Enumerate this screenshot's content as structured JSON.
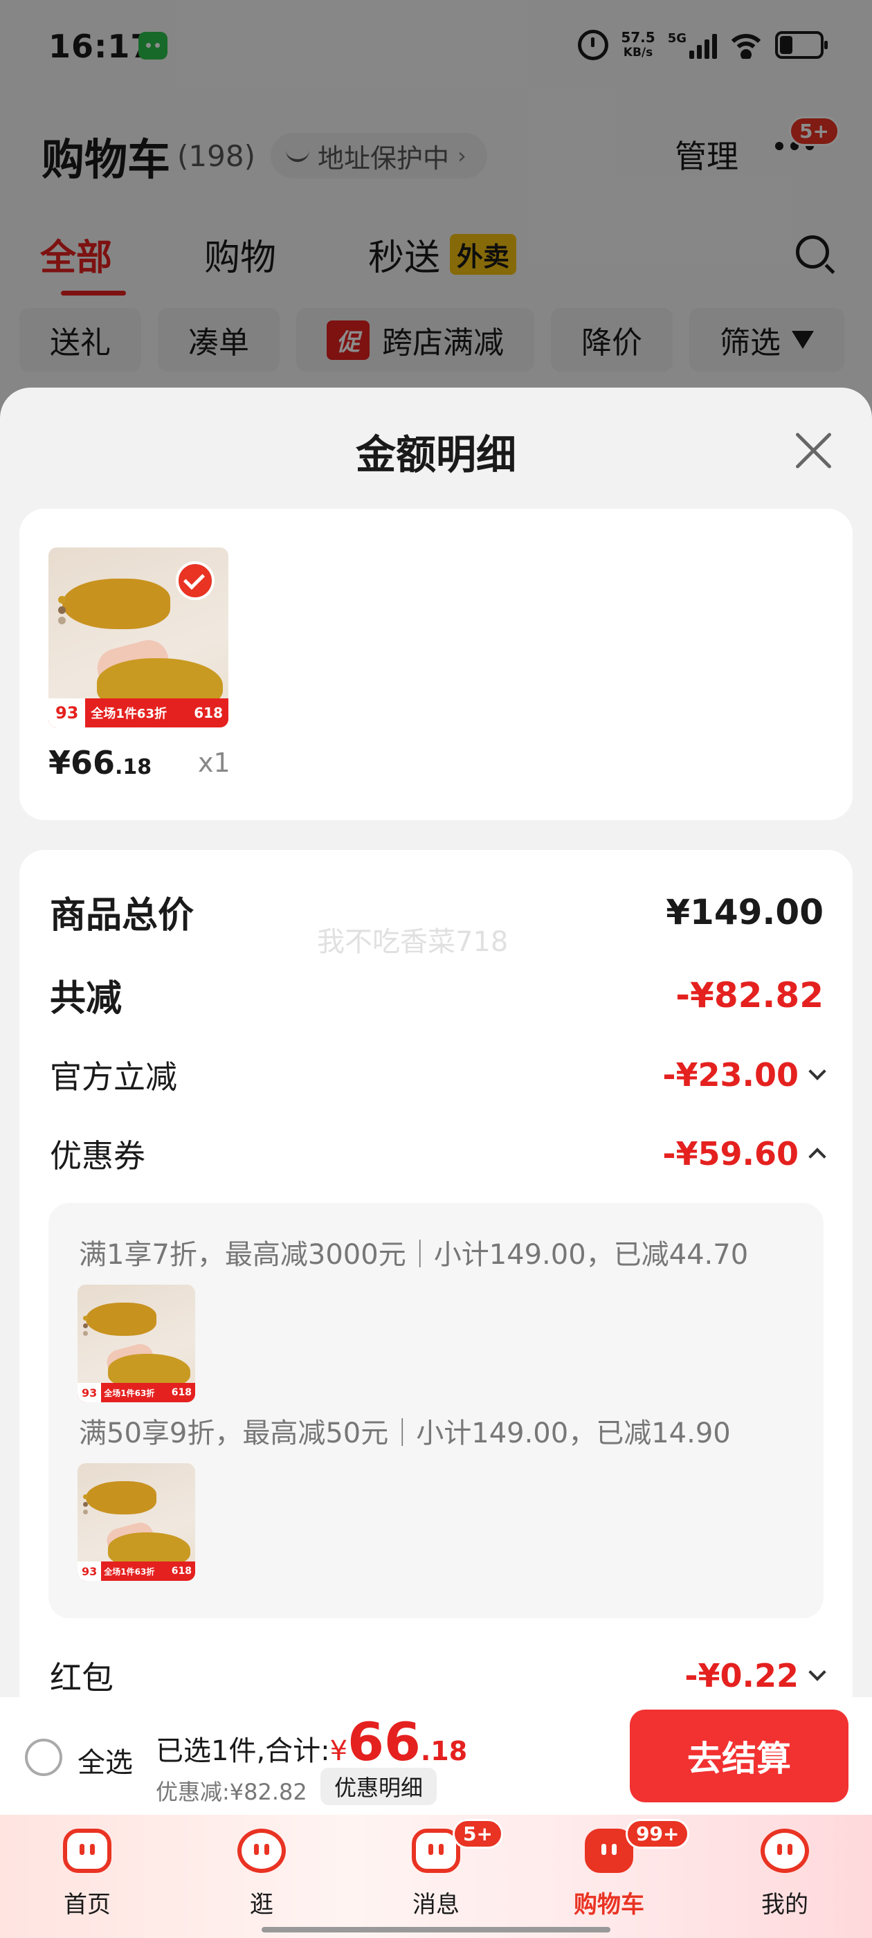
{
  "status_bar": {
    "time": "16:17",
    "net_speed": "57.5",
    "net_unit": "KB/s",
    "network": "5G"
  },
  "header": {
    "title": "购物车",
    "count": "(198)",
    "address_chip": "地址保护中",
    "manage": "管理",
    "more_badge": "5+"
  },
  "tabs": [
    {
      "label": "全部"
    },
    {
      "label": "购物"
    },
    {
      "label": "秒送"
    }
  ],
  "waimai_tag": "外卖",
  "filter_chips": [
    "送礼",
    "凑单",
    "跨店满减",
    "降价",
    "筛选"
  ],
  "promo_tag": "促",
  "sheet": {
    "title": "金额明细",
    "item": {
      "price_int": "¥66",
      "price_dec": ".18",
      "qty": "x1",
      "thumb_price": "93",
      "thumb_promo": "全场1件63折",
      "thumb_618": "618"
    },
    "watermark": "我不吃香菜718",
    "rows": {
      "total_label": "商品总价",
      "total_value": "¥149.00",
      "reduce_label": "共减",
      "reduce_value": "-¥82.82",
      "official_label": "官方立减",
      "official_value": "-¥23.00",
      "coupon_label": "优惠券",
      "coupon_value": "-¥59.60",
      "redpacket_label": "红包",
      "redpacket_value": "-¥0.22"
    },
    "coupons": [
      {
        "text": "满1享7折，最高减3000元｜小计149.00，已减44.70"
      },
      {
        "text": "满50享9折，最高减50元｜小计149.00，已减14.90"
      }
    ]
  },
  "checkout": {
    "select_all": "全选",
    "selected_text": "已选1件,合计:",
    "currency": "¥",
    "total_int": "66",
    "total_dec": ".18",
    "discount": "优惠减:¥82.82",
    "detail_button": "优惠明细",
    "checkout_button": "去结算"
  },
  "nav": [
    {
      "label": "首页"
    },
    {
      "label": "逛"
    },
    {
      "label": "消息",
      "badge": "5+"
    },
    {
      "label": "购物车",
      "badge": "99+"
    },
    {
      "label": "我的"
    }
  ],
  "colors": {
    "accent": "#e4211f",
    "checkout": "#f23131",
    "waimai": "#f5c211"
  }
}
